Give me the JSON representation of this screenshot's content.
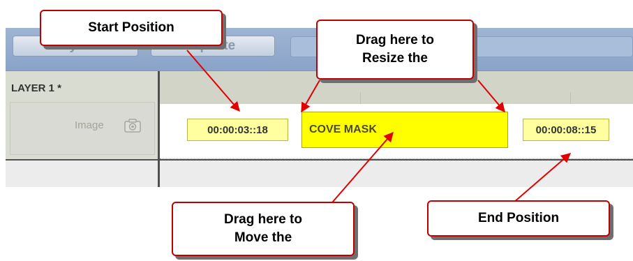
{
  "toolbar": {
    "layers_label": "Layers",
    "update_label": "Update"
  },
  "layer": {
    "title": "LAYER 1 *",
    "type_label": "Image",
    "icon": "camera-icon"
  },
  "clip": {
    "start_time": "00:00:03::18",
    "name": "COVE MASK",
    "end_time": "00:00:08::15"
  },
  "callouts": {
    "start_position": "Start Position",
    "resize_line1": "Drag here to",
    "resize_line2": "Resize the",
    "move_line1": "Drag here to",
    "move_line2": "Move the",
    "end_position": "End Position"
  },
  "colors": {
    "callout_border": "#c00000",
    "arrow": "#e00000",
    "clip_fill": "#ffff00",
    "time_box_fill": "#ffff9f",
    "toolbar": "#9fb4d3"
  }
}
